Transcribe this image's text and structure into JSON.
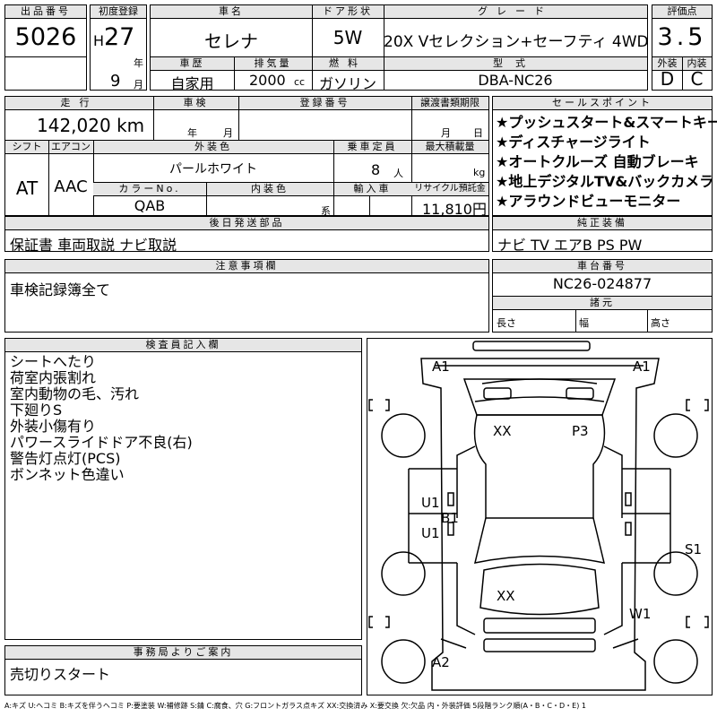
{
  "lot": {
    "header": "出品番号",
    "value": "5026"
  },
  "reg": {
    "header": "初度登録",
    "era": "H",
    "year": "27",
    "year_unit": "年",
    "month": "9",
    "month_unit": "月"
  },
  "car_name": {
    "header": "車名",
    "value": "セレナ"
  },
  "door": {
    "header": "ドア形状",
    "value": "5W"
  },
  "grade": {
    "header": "グレード",
    "value": "20X Vセレクション+セーフティ 4WD"
  },
  "score": {
    "header": "評価点",
    "value": "3.5"
  },
  "history": {
    "header": "車歴",
    "value": "自家用"
  },
  "displacement": {
    "header": "排気量",
    "value": "2000",
    "unit": "cc"
  },
  "fuel": {
    "header": "燃料",
    "value": "ガソリン"
  },
  "model_code": {
    "header": "型式",
    "value": "DBA-NC26"
  },
  "ext_grade": {
    "header": "外装",
    "value": "D"
  },
  "int_grade": {
    "header": "内装",
    "value": "C"
  },
  "mileage": {
    "header": "走行",
    "value": "142,020 km"
  },
  "inspection": {
    "header": "車検",
    "year_unit": "年",
    "month_unit": "月"
  },
  "plate": {
    "header": "登録番号"
  },
  "doc_deadline": {
    "header": "譲渡書類期限",
    "month_unit": "月",
    "day_unit": "日"
  },
  "shift": {
    "header": "シフト",
    "value": "AT"
  },
  "aircon": {
    "header": "エアコン",
    "value": "AAC"
  },
  "ext_color": {
    "header": "外装色",
    "value": "パールホワイト"
  },
  "color_no": {
    "header": "カラーNo.",
    "value": "QAB"
  },
  "int_color": {
    "header": "内装色",
    "suffix": "系"
  },
  "import": {
    "header": "輸入車"
  },
  "capacity": {
    "header": "乗車定員",
    "value": "8",
    "unit": "人"
  },
  "max_load": {
    "header": "最大積載量",
    "unit": "kg"
  },
  "recycle": {
    "header": "リサイクル預託金",
    "value": "11,810円"
  },
  "later_parts": {
    "header": "後日発送部品",
    "value": "保証書 車両取説 ナビ取説"
  },
  "sales_points": {
    "header": "セールスポイント",
    "items": [
      "★プッシュスタート&スマートキー",
      "★ディスチャージライト",
      "★オートクルーズ 自動ブレーキ",
      "★地上デジタルTV&バックカメラ",
      "★アラウンドビューモニター"
    ]
  },
  "equipment": {
    "header": "純正装備",
    "value": "ナビ TV エアB PS PW"
  },
  "notes": {
    "header": "注意事項欄",
    "value": "車検記録簿全て"
  },
  "chassis": {
    "header": "車台番号",
    "value": "NC26-024877"
  },
  "specs": {
    "header": "諸元",
    "length": "長さ",
    "width": "幅",
    "height": "高さ"
  },
  "inspector": {
    "header": "検査員記入欄",
    "lines": [
      "シートへたり",
      "荷室内張割れ",
      "室内動物の毛、汚れ",
      "下廻りS",
      "外装小傷有り",
      "パワースライドドア不良(右)",
      "警告灯点灯(PCS)",
      "ボンネット色違い"
    ]
  },
  "office": {
    "header": "事務局よりご案内",
    "value": "売切りスタート"
  },
  "damage_marks": {
    "a1_left": "A1",
    "a1_right": "A1",
    "xx_roof": "XX",
    "p3": "P3",
    "u1_upper": "U1",
    "b1": "B1",
    "u1_lower": "U1",
    "s1": "S1",
    "xx_rear": "XX",
    "w1": "W1",
    "a2": "A2"
  },
  "legend": "A:キズ U:ヘコミ B:キズを伴うヘコミ P:要塗装 W:補修跡 S:錆 C:腐食、穴 G:フロントガラス点キズ XX:交換済み X:要交換 欠:欠品 内・外装評価 5段階ランク順(A・B・C・D・E) 1"
}
